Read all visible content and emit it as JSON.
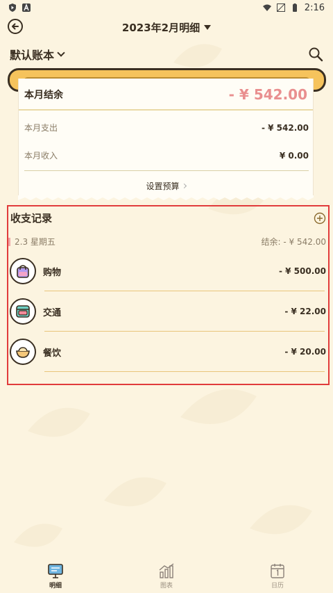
{
  "status_bar": {
    "time": "2:16"
  },
  "header": {
    "title": "2023年2月明细"
  },
  "account_book": {
    "name": "默认账本"
  },
  "summary": {
    "balance_label": "本月结余",
    "balance_value": "- ¥ 542.00",
    "expense_label": "本月支出",
    "expense_value": "- ¥ 542.00",
    "income_label": "本月收入",
    "income_value": "¥ 0.00",
    "budget_label": "设置预算"
  },
  "records": {
    "title": "收支记录",
    "day": {
      "date": "2.3 星期五",
      "balance_label": "结余:",
      "balance_value": "- ¥ 542.00"
    },
    "items": [
      {
        "name": "购物",
        "amount": "- ¥ 500.00",
        "icon": "shopping-bag-icon"
      },
      {
        "name": "交通",
        "amount": "- ¥ 22.00",
        "icon": "bus-icon"
      },
      {
        "name": "餐饮",
        "amount": "- ¥ 20.00",
        "icon": "food-bowl-icon"
      }
    ]
  },
  "tabs": [
    {
      "label": "明细",
      "icon": "detail-board-icon",
      "active": true
    },
    {
      "label": "图表",
      "icon": "chart-icon",
      "active": false
    },
    {
      "label": "日历",
      "icon": "calendar-icon",
      "active": false
    }
  ],
  "colors": {
    "background": "#fcf4e0",
    "accent_yellow": "#f6c35c",
    "balance_red": "#e98f8f",
    "highlight_border": "#e13b3b"
  }
}
